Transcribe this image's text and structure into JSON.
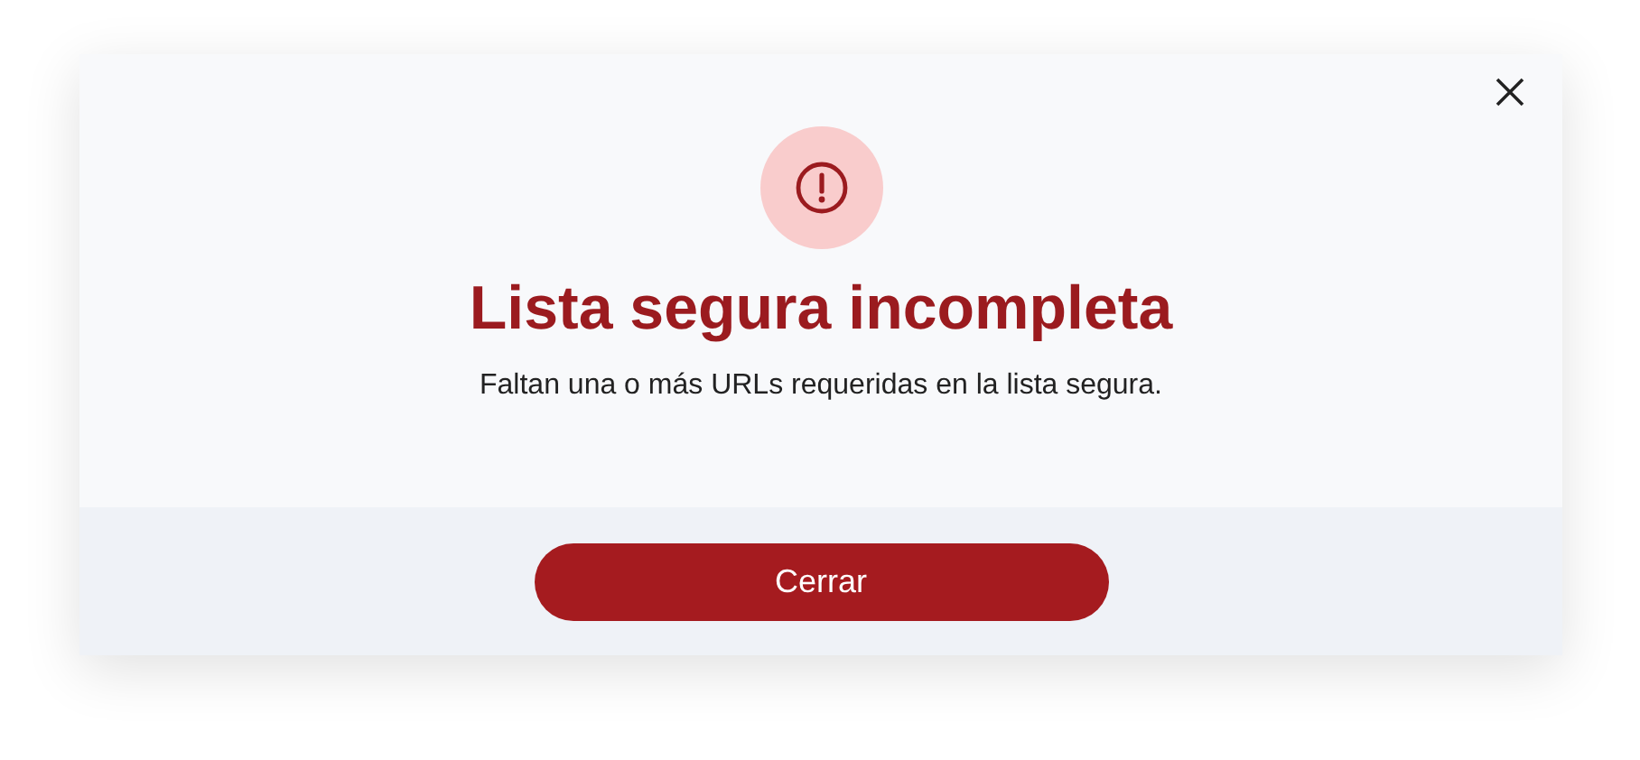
{
  "dialog": {
    "title": "Lista segura incompleta",
    "message": "Faltan una o más URLs requeridas en la lista segura.",
    "buttons": [
      "Cerrar"
    ]
  }
}
